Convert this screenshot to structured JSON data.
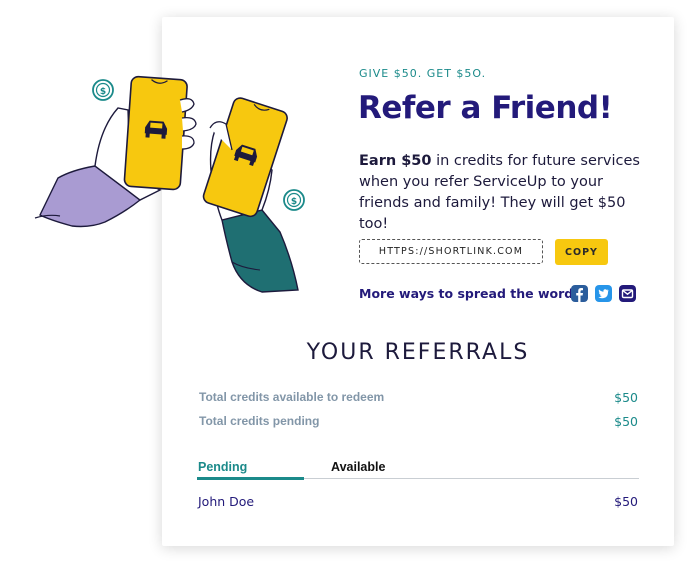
{
  "hero": {
    "tagline": "GIVE $50. GET $5O.",
    "title": "Refer a Friend!",
    "description_bold": "Earn $50",
    "description_rest": " in credits for future services when you refer ServiceUp to your friends and family! They will get $50 too!"
  },
  "share": {
    "link": "HTTPS://SHORTLINK.COM",
    "copy_label": "COPY",
    "spread_label": "More ways to spread the word!",
    "icons": [
      "facebook-icon",
      "twitter-icon",
      "email-icon"
    ]
  },
  "referrals": {
    "title": "YOUR REFERRALS",
    "credits": [
      {
        "label": "Total credits available to redeem",
        "value": "$50"
      },
      {
        "label": "Total credits pending",
        "value": "$50"
      }
    ],
    "tabs": [
      {
        "label": "Pending",
        "active": true
      },
      {
        "label": "Available",
        "active": false
      }
    ],
    "rows": [
      {
        "name": "John Doe",
        "amount": "$50"
      }
    ]
  },
  "colors": {
    "primary": "#231a7a",
    "accent": "#1b8a8a",
    "button": "#f7c80f",
    "phone": "#f7c80f",
    "left_sleeve": "#a99bd2",
    "right_sleeve": "#1f6f72"
  }
}
